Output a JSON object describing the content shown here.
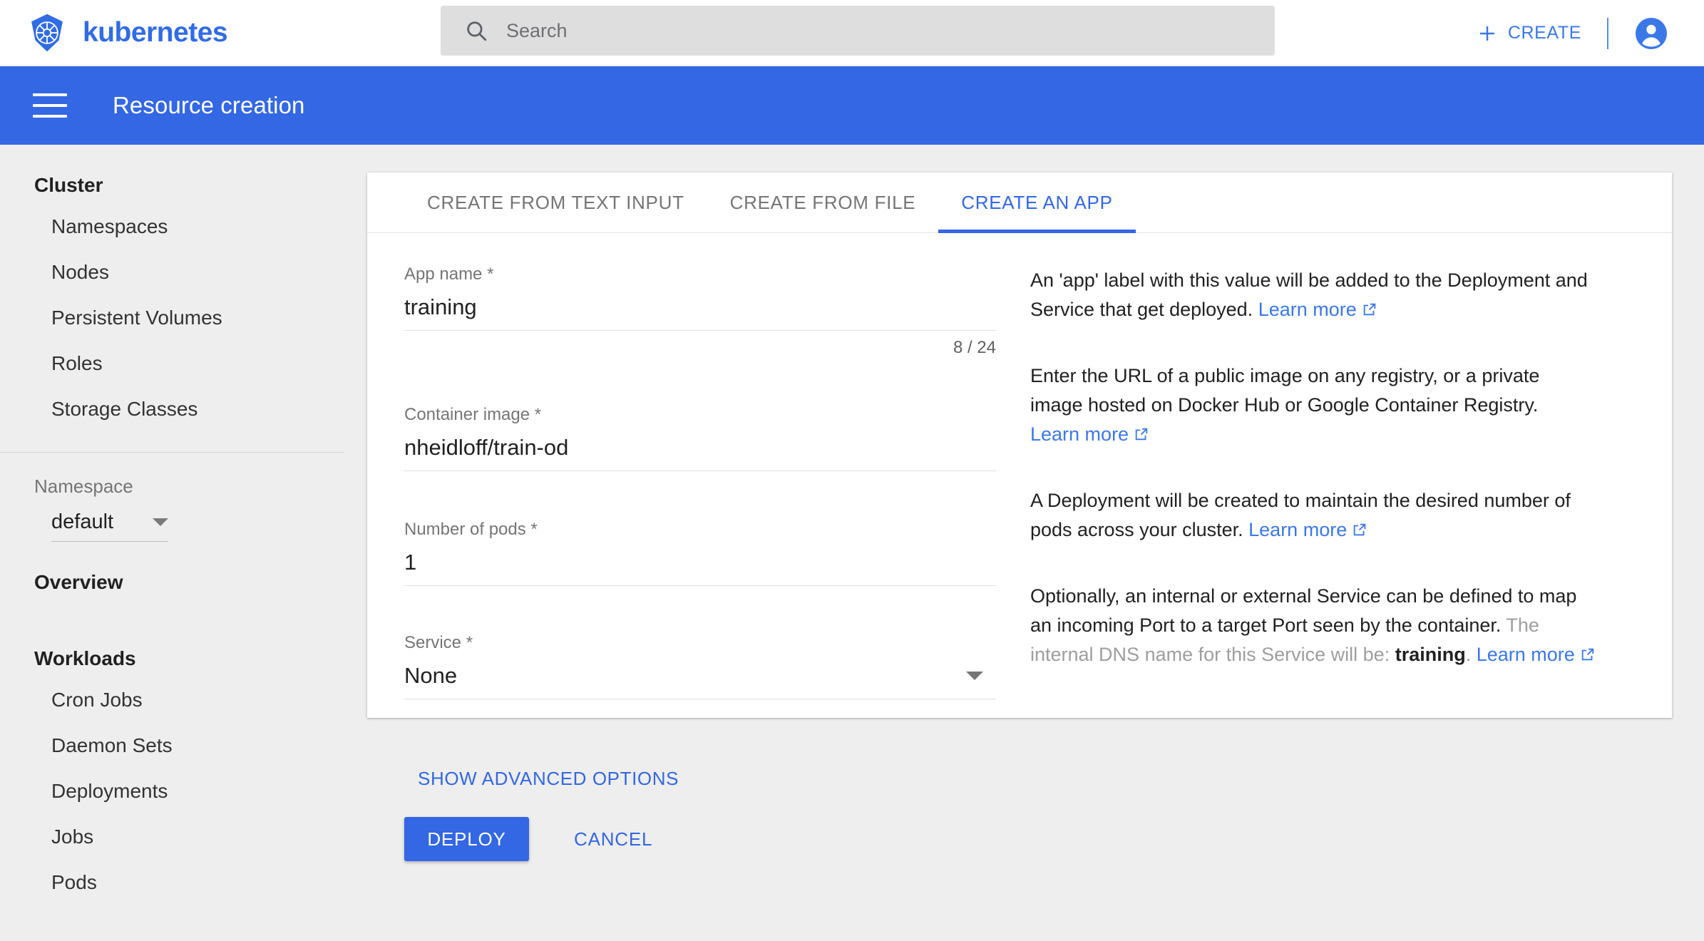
{
  "topbar": {
    "brand_name": "kubernetes",
    "logo_icon": "kubernetes-helm-icon",
    "search": {
      "placeholder": "Search",
      "value": "",
      "icon": "search-icon"
    },
    "create_label": "CREATE",
    "create_icon": "plus-icon",
    "account_icon": "account-circle-icon"
  },
  "header": {
    "menu_icon": "hamburger-menu-icon",
    "title": "Resource creation",
    "background_color": "#3367e3"
  },
  "sidebar": {
    "cluster_title": "Cluster",
    "cluster_items": [
      {
        "label": "Namespaces"
      },
      {
        "label": "Nodes"
      },
      {
        "label": "Persistent Volumes"
      },
      {
        "label": "Roles"
      },
      {
        "label": "Storage Classes"
      }
    ],
    "namespace_label": "Namespace",
    "namespace_value": "default",
    "namespace_caret_icon": "chevron-down-icon",
    "overview_title": "Overview",
    "workloads_title": "Workloads",
    "workloads_items": [
      {
        "label": "Cron Jobs"
      },
      {
        "label": "Daemon Sets"
      },
      {
        "label": "Deployments"
      },
      {
        "label": "Jobs"
      },
      {
        "label": "Pods"
      }
    ]
  },
  "card": {
    "tabs": [
      {
        "label": "CREATE FROM TEXT INPUT",
        "active": false
      },
      {
        "label": "CREATE FROM FILE",
        "active": false
      },
      {
        "label": "CREATE AN APP",
        "active": true
      }
    ],
    "accent_color": "#3367e3",
    "form": {
      "app_name": {
        "label": "App name *",
        "value": "training",
        "placeholder": "",
        "counter": "8 / 24"
      },
      "container_image": {
        "label": "Container image *",
        "value": "nheidloff/train-od",
        "placeholder": ""
      },
      "number_of_pods": {
        "label": "Number of pods *",
        "value": "1",
        "placeholder": ""
      },
      "service": {
        "label": "Service *",
        "value": "None",
        "caret_icon": "chevron-down-icon"
      },
      "advanced_options_label": "SHOW ADVANCED OPTIONS",
      "deploy_label": "DEPLOY",
      "cancel_label": "CANCEL"
    },
    "help": {
      "p1_text": "An 'app' label with this value will be added to the Deployment and Service that get deployed. ",
      "p1_link": "Learn more",
      "p2_text": "Enter the URL of a public image on any registry, or a private image hosted on Docker Hub or Google Container Registry. ",
      "p2_link": "Learn more",
      "p3_text": "A Deployment will be created to maintain the desired number of pods across your cluster. ",
      "p3_link": "Learn more",
      "p4_text": "Optionally, an internal or external Service can be defined to map an incoming Port to a target Port seen by the container. ",
      "p4_muted": "The internal DNS name for this Service will be: ",
      "p4_value": "training",
      "p4_suffix": ". ",
      "p4_link": "Learn more",
      "link_icon": "external-link-icon"
    }
  }
}
